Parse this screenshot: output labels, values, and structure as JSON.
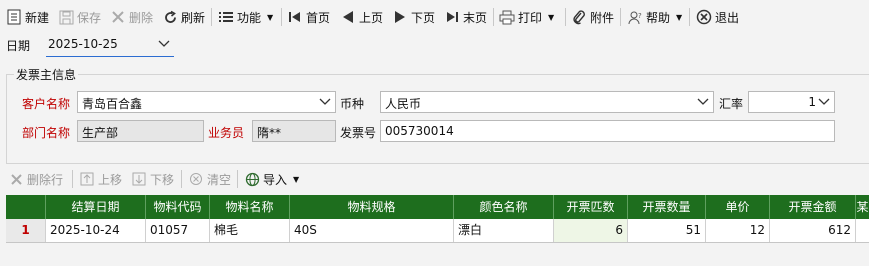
{
  "toolbar": {
    "new": "新建",
    "save": "保存",
    "delete": "删除",
    "refresh": "刷新",
    "function": "功能",
    "first": "首页",
    "prev": "上页",
    "next": "下页",
    "last": "末页",
    "print": "打印",
    "attach": "附件",
    "help": "帮助",
    "exit": "退出"
  },
  "header": {
    "date_label": "日期",
    "date_value": "2025-10-25",
    "group_title": "发票主信息",
    "customer_label": "客户名称",
    "customer_value": "青岛百合鑫",
    "currency_label": "币种",
    "currency_value": "人民币",
    "rate_label": "汇率",
    "rate_value": "1",
    "dept_label": "部门名称",
    "dept_value": "生产部",
    "salesman_label": "业务员",
    "salesman_value": "隋**",
    "invoice_no_label": "发票号",
    "invoice_no_value": "005730014"
  },
  "detail_toolbar": {
    "delete_row": "删除行",
    "move_up": "上移",
    "move_down": "下移",
    "clear": "清空",
    "import": "导入"
  },
  "grid": {
    "columns": [
      "结算日期",
      "物料代码",
      "物料名称",
      "物料规格",
      "颜色名称",
      "开票匹数",
      "开票数量",
      "单价",
      "开票金额",
      "某"
    ],
    "rows": [
      {
        "num": "1",
        "date": "2025-10-24",
        "code": "01057",
        "name": "棉毛",
        "spec": "40S",
        "color": "漂白",
        "pieces": "6",
        "qty": "51",
        "price": "12",
        "amount": "612"
      }
    ]
  },
  "colors": {
    "grid_header": "#1e6e1e",
    "required_label": "#c00000"
  }
}
